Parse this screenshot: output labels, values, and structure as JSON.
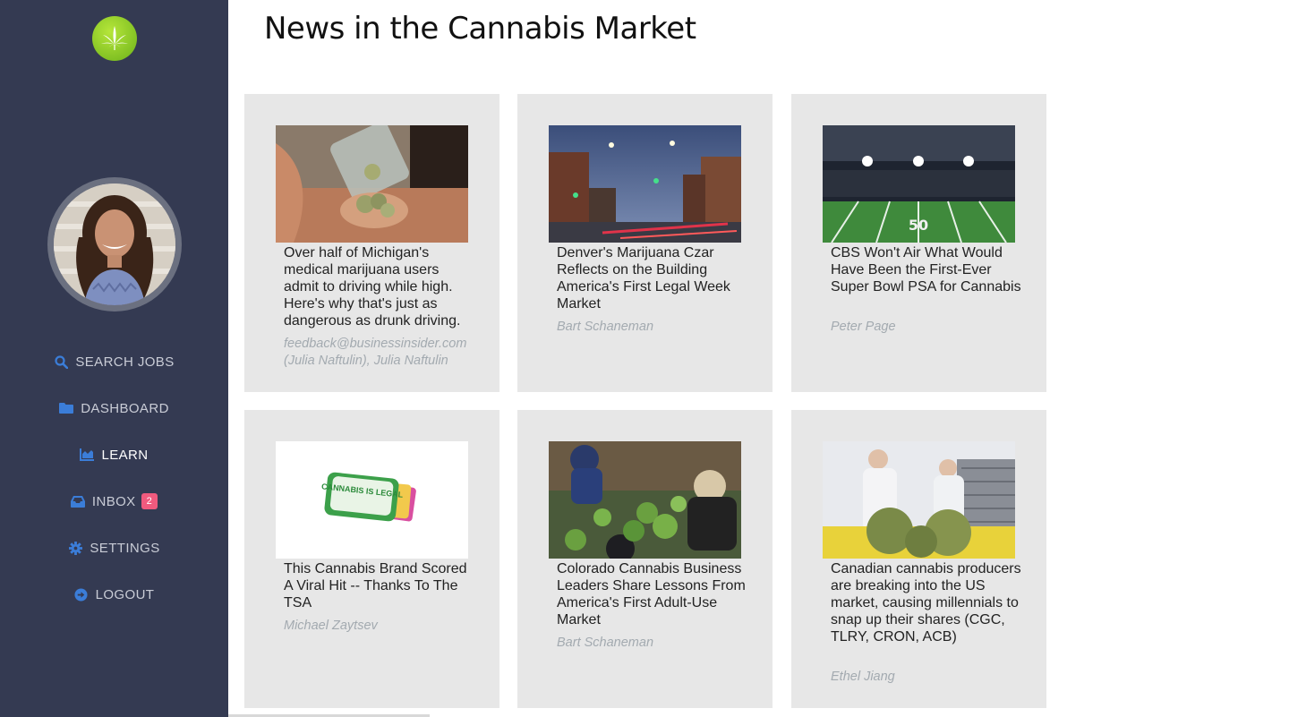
{
  "app": {
    "logo_icon": "cannabis-leaf-icon",
    "colors": {
      "sidebar_bg": "#343a52",
      "icon_blue": "#3b7dd8",
      "badge": "#f05a7e",
      "card_bg": "#e7e7e7"
    }
  },
  "sidebar": {
    "items": [
      {
        "label": "SEARCH JOBS",
        "icon": "search-icon"
      },
      {
        "label": "DASHBOARD",
        "icon": "folder-icon"
      },
      {
        "label": "LEARN",
        "icon": "chart-icon",
        "active": true
      },
      {
        "label": "INBOX",
        "icon": "inbox-icon",
        "badge": "2"
      },
      {
        "label": "SETTINGS",
        "icon": "gear-icon"
      },
      {
        "label": "LOGOUT",
        "icon": "logout-icon"
      }
    ]
  },
  "main": {
    "title": "News in the Cannabis Market",
    "articles": [
      {
        "title": "Over half of Michigan's medical marijuana users admit to driving while high. Here's why that's just as dangerous as drunk driving.",
        "author": "feedback@businessinsider.com (Julia Naftulin), Julia Naftulin"
      },
      {
        "title": "Denver's Marijuana Czar Reflects on the Building America's First Legal Week Market",
        "author": "Bart Schaneman"
      },
      {
        "title": "CBS Won't Air What Would Have Been the First-Ever Super Bowl PSA for Cannabis",
        "author": "Peter Page"
      },
      {
        "title": "This Cannabis Brand Scored A Viral Hit -- Thanks To The TSA",
        "author": "Michael Zaytsev",
        "image_text": "CANNABIS IS LEGAL"
      },
      {
        "title": "Colorado Cannabis Business Leaders Share Lessons From America's First Adult-Use Market",
        "author": "Bart Schaneman"
      },
      {
        "title": "Canadian cannabis producers are breaking into the US market, causing millennials to snap up their shares (CGC, TLRY, CRON, ACB)",
        "author": "Ethel Jiang"
      }
    ]
  }
}
